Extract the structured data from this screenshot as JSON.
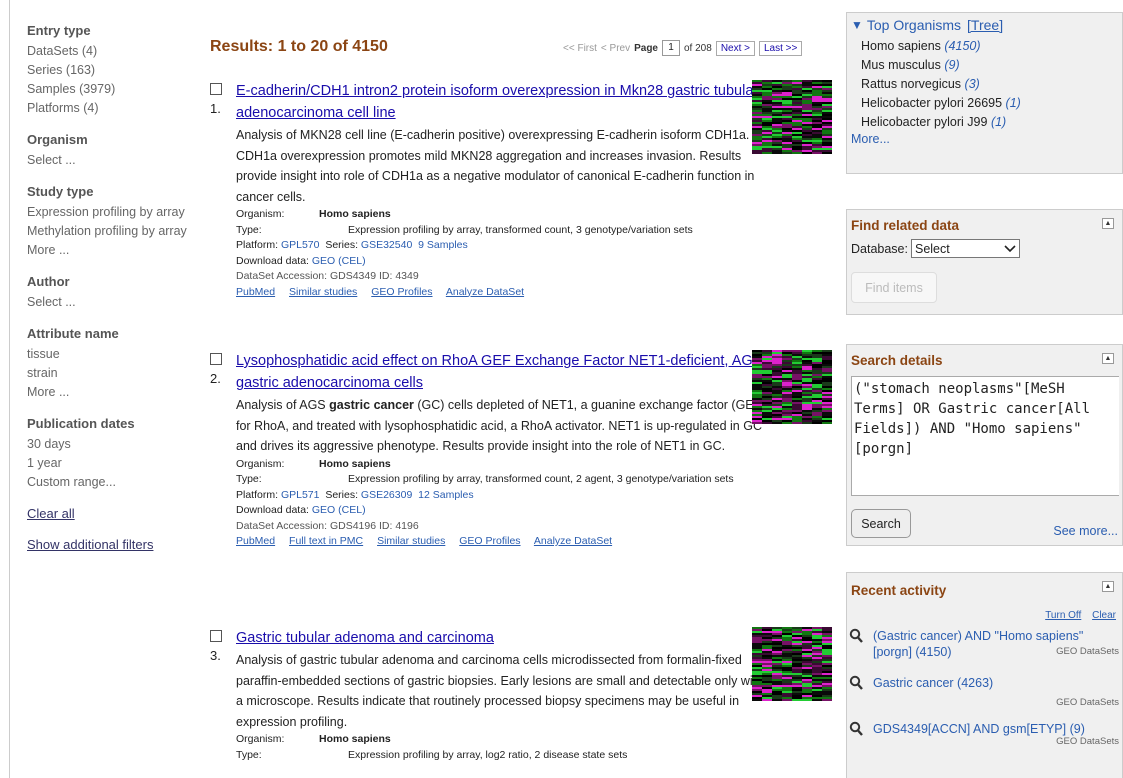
{
  "filters": {
    "entry_type": {
      "heading": "Entry type",
      "items": [
        "DataSets (4)",
        "Series (163)",
        "Samples (3979)",
        "Platforms (4)"
      ]
    },
    "organism": {
      "heading": "Organism",
      "items": [
        "Select ..."
      ]
    },
    "study_type": {
      "heading": "Study type",
      "items": [
        "Expression profiling by array",
        "Methylation profiling by array",
        "More ..."
      ]
    },
    "author": {
      "heading": "Author",
      "items": [
        "Select ..."
      ]
    },
    "attribute": {
      "heading": "Attribute name",
      "items": [
        "tissue",
        "strain",
        "More ..."
      ]
    },
    "pub_dates": {
      "heading": "Publication dates",
      "items": [
        "30 days",
        "1 year",
        "Custom range..."
      ]
    },
    "clear_all": "Clear all",
    "show_additional": "Show additional filters"
  },
  "results_header": "Results: 1 to 20 of 4150",
  "pager": {
    "first": "<< First",
    "prev": "< Prev",
    "page_label": "Page",
    "page": "1",
    "of": "of 208",
    "next": "Next >",
    "last": "Last >>"
  },
  "results": [
    {
      "num": "1.",
      "title": "E-cadherin/CDH1 intron2 protein isoform overexpression in Mkn28 gastric tubular adenocarcinoma cell line",
      "summary": "Analysis of MKN28 cell line (E-cadherin positive) overexpressing E-cadherin isoform CDH1a. CDH1a overexpression promotes mild MKN28 aggregation and increases invasion. Results provide insight into role of CDH1a as a negative modulator of canonical E-cadherin function in cancer cells.",
      "organism_label": "Organism:",
      "organism": "Homo sapiens",
      "type_label": "Type:",
      "type": "Expression profiling by array, transformed count, 3 genotype/variation sets",
      "platform_label": "Platform:",
      "platform": "GPL570",
      "series_label": "Series:",
      "series": "GSE32540",
      "samples": "9 Samples",
      "download_label": "Download data:",
      "download": "GEO (CEL)",
      "dataset_line": "DataSet   Accession: GDS4349   ID: 4349",
      "links": [
        "PubMed",
        "Similar studies",
        "GEO Profiles",
        "Analyze DataSet"
      ]
    },
    {
      "num": "2.",
      "title": "Lysophosphatidic acid effect on RhoA GEF Exchange Factor NET1-deficient, AGS gastric adenocarcinoma cells",
      "summary_pre": "Analysis of AGS ",
      "summary_bold": "gastric cancer",
      "summary_post": " (GC) cells depleted of NET1, a guanine exchange factor (GEF) for RhoA, and treated with lysophosphatidic acid, a RhoA activator. NET1 is up-regulated in GC and drives its aggressive phenotype. Results provide insight into the role of NET1 in GC.",
      "organism_label": "Organism:",
      "organism": "Homo sapiens",
      "type_label": "Type:",
      "type": "Expression profiling by array, transformed count, 2 agent, 3 genotype/variation sets",
      "platform_label": "Platform:",
      "platform": "GPL571",
      "series_label": "Series:",
      "series": "GSE26309",
      "samples": "12 Samples",
      "download_label": "Download data:",
      "download": "GEO (CEL)",
      "dataset_line": "DataSet   Accession: GDS4196   ID: 4196",
      "links": [
        "PubMed",
        "Full text in PMC",
        "Similar studies",
        "GEO Profiles",
        "Analyze DataSet"
      ]
    },
    {
      "num": "3.",
      "title": "Gastric tubular adenoma and carcinoma",
      "summary": "Analysis of gastric tubular adenoma and carcinoma cells microdissected from formalin-fixed paraffin-embedded sections of gastric biopsies. Early lesions are small and detectable only with a microscope. Results indicate that routinely processed biopsy specimens may be useful in expression profiling.",
      "organism_label": "Organism:",
      "organism": "Homo sapiens",
      "type_label": "Type:",
      "type": "Expression profiling by array, log2 ratio, 2 disease state sets"
    }
  ],
  "top_organisms": {
    "title": "Top Organisms",
    "tree": "[Tree]",
    "items": [
      {
        "name": "Homo sapiens",
        "count": "(4150)"
      },
      {
        "name": "Mus musculus",
        "count": "(9)"
      },
      {
        "name": "Rattus norvegicus",
        "count": "(3)"
      },
      {
        "name": "Helicobacter pylori 26695",
        "count": "(1)"
      },
      {
        "name": "Helicobacter pylori J99",
        "count": "(1)"
      }
    ],
    "more": "More..."
  },
  "related": {
    "title": "Find related data",
    "db_label": "Database:",
    "db_value": "Select",
    "find_button": "Find items"
  },
  "search_details": {
    "title": "Search details",
    "query": "(\"stomach neoplasms\"[MeSH Terms] OR Gastric cancer[All Fields]) AND \"Homo sapiens\"[porgn]",
    "search_button": "Search",
    "see_more": "See more..."
  },
  "recent": {
    "title": "Recent activity",
    "turn_off": "Turn Off",
    "clear": "Clear",
    "items": [
      {
        "text": "(Gastric cancer) AND \"Homo sapiens\"[porgn] (4150)",
        "source": "GEO DataSets"
      },
      {
        "text": "Gastric cancer (4263)",
        "source": "GEO DataSets"
      },
      {
        "text": "GDS4349[ACCN] AND gsm[ETYP] (9)",
        "source": "GEO DataSets"
      }
    ]
  },
  "colors": {
    "link": "#1a0dab",
    "header": "#8b4513",
    "heat_green": "#22cc33",
    "heat_magenta": "#dd22cc"
  },
  "icons": {
    "search": "magnifier-icon",
    "collapse": "collapse-icon",
    "tree_toggle": "triangle-down-icon"
  }
}
